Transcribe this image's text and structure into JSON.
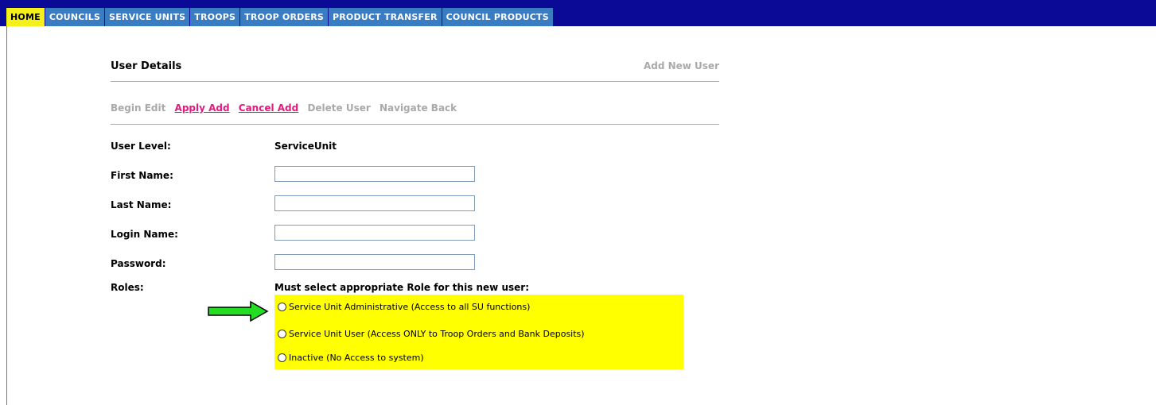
{
  "nav": {
    "tabs": [
      {
        "label": "HOME"
      },
      {
        "label": "COUNCILS"
      },
      {
        "label": "SERVICE UNITS"
      },
      {
        "label": "TROOPS"
      },
      {
        "label": "TROOP ORDERS"
      },
      {
        "label": "PRODUCT TRANSFER"
      },
      {
        "label": "COUNCIL PRODUCTS"
      }
    ],
    "active_tab": "HOME"
  },
  "panel": {
    "title": "User Details",
    "add_new": "Add New User",
    "actions": {
      "begin_edit": "Begin Edit",
      "apply_add": "Apply Add",
      "cancel_add": "Cancel Add",
      "delete_user": "Delete User",
      "navigate_back": "Navigate Back"
    }
  },
  "form": {
    "user_level_label": "User Level:",
    "user_level_value": "ServiceUnit",
    "first_name_label": "First Name:",
    "first_name_value": "",
    "last_name_label": "Last Name:",
    "last_name_value": "",
    "login_name_label": "Login Name:",
    "login_name_value": "",
    "password_label": "Password:",
    "password_value": "",
    "roles_label": "Roles:",
    "roles_instruction": "Must select appropriate Role for this new user:",
    "roles": [
      {
        "label": "Service Unit Administrative (Access to all SU functions)",
        "selected": false
      },
      {
        "label": "Service Unit User (Access ONLY to Troop Orders and Bank Deposits)",
        "selected": false
      },
      {
        "label": "Inactive (No Access to system)",
        "selected": false
      }
    ]
  },
  "colors": {
    "nav_bg": "#0a0a96",
    "tab_bg": "#3a7cc2",
    "tab_active": "#f5f01a",
    "link": "#e6197e",
    "disabled": "#a9a9a9",
    "highlight": "#ffff00",
    "arrow": "#22dd22"
  },
  "icons": {
    "pointer": "green-arrow-icon"
  }
}
